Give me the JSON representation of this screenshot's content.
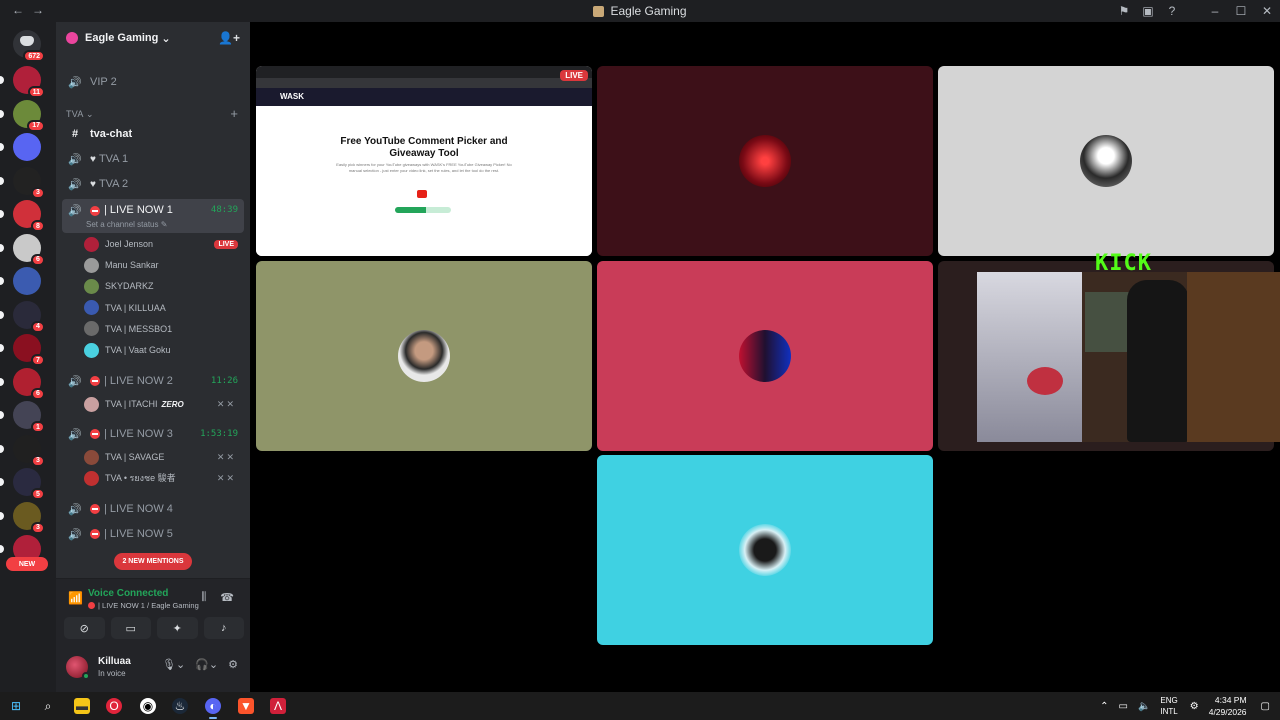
{
  "window": {
    "title": "Eagle Gaming",
    "back": "←",
    "forward": "→",
    "icons": {
      "inbox": "inbox-icon",
      "help": "?"
    },
    "controls": {
      "minimize": "–",
      "maximize": "☐",
      "close": "✕"
    }
  },
  "guilds": {
    "home_badge": "672",
    "items": [
      {
        "badge": "11",
        "color": "#b0203a"
      },
      {
        "badge": "17",
        "color": "#6c8a3a"
      },
      {
        "badge": "",
        "color": "#5865f2"
      },
      {
        "badge": "3",
        "color": "#222222"
      },
      {
        "badge": "8",
        "color": "#d0303a"
      },
      {
        "badge": "6",
        "color": "#c9c9c9"
      },
      {
        "badge": "",
        "color": "#3b5bb0"
      },
      {
        "badge": "4",
        "color": "#2a2a3a"
      },
      {
        "badge": "7",
        "color": "#8a1020"
      },
      {
        "badge": "6",
        "color": "#b02030"
      },
      {
        "badge": "1",
        "color": "#444455"
      },
      {
        "badge": "3",
        "color": "#202020"
      },
      {
        "badge": "5",
        "color": "#2a2a40"
      },
      {
        "badge": "3",
        "color": "#6a5a20"
      },
      {
        "badge": "",
        "color": "#b0203a"
      }
    ],
    "new_label": "NEW"
  },
  "server": {
    "name": "Eagle Gaming",
    "chevron": "⌄"
  },
  "channels": {
    "vip2": "VIP 2",
    "category": "TVA",
    "text_channel": "tva-chat",
    "tva1": "TVA 1",
    "tva2": "TVA 2",
    "live1": {
      "name": "| LIVE NOW 1",
      "time": "48:39",
      "status": "Set a channel status"
    },
    "live1_users": [
      {
        "name": "Joel Jenson",
        "live": "LIVE",
        "color": "#b0203a"
      },
      {
        "name": "Manu Sankar",
        "live": "",
        "color": "#9a9a9a"
      },
      {
        "name": "SKYDARKZ",
        "live": "",
        "color": "#6a8a4a"
      },
      {
        "name": "TVA | KILLUAA",
        "live": "",
        "color": "#3a5ab0"
      },
      {
        "name": "TVA | MESSBO1",
        "live": "",
        "color": "#6a6a6a"
      },
      {
        "name": "TVA | Vaat Goku",
        "live": "",
        "color": "#4ad0e0"
      }
    ],
    "live2": {
      "name": "| LIVE NOW 2",
      "time": "11:26"
    },
    "live2_users": [
      {
        "name": "TVA | ITACHI",
        "tag": "ZERO",
        "color": "#c9a0a0"
      }
    ],
    "live3": {
      "name": "| LIVE NOW 3",
      "time": "1:53:19"
    },
    "live3_users": [
      {
        "name": "TVA | SAVAGE",
        "color": "#8a4a3a"
      },
      {
        "name": "TVA • รยงชe 駿者",
        "color": "#c03030"
      }
    ],
    "live4": "| LIVE NOW 4",
    "live5": "| LIVE NOW 5",
    "mentions": "2 NEW MENTIONS"
  },
  "voice": {
    "title": "Voice Connected",
    "sub": "| LIVE NOW 1 / Eagle Gaming"
  },
  "user": {
    "name": "Killuaa",
    "status": "In voice"
  },
  "stage": {
    "stream": {
      "site_logo": "WASK",
      "headline_1": "Free YouTube Comment Picker and",
      "headline_2": "Giveaway Tool",
      "body": "Easily pick winners for your YouTube giveaways with WASK's FREE YouTube Giveaway Picker! No manual selection - just enter your video link, set the rules, and let the tool do the rest.",
      "live": "LIVE",
      "progress": 0.55
    },
    "tile_colors": [
      "#3d1018",
      "#d4d4d4",
      "#8f9569",
      "#c93c58",
      "#2b1e1e",
      "#3fd1e2"
    ],
    "kick_label": "KICK"
  },
  "taskbar": {
    "lang_1": "ENG",
    "lang_2": "INTL",
    "time": "4:34 PM",
    "date": "4/29/2026"
  }
}
